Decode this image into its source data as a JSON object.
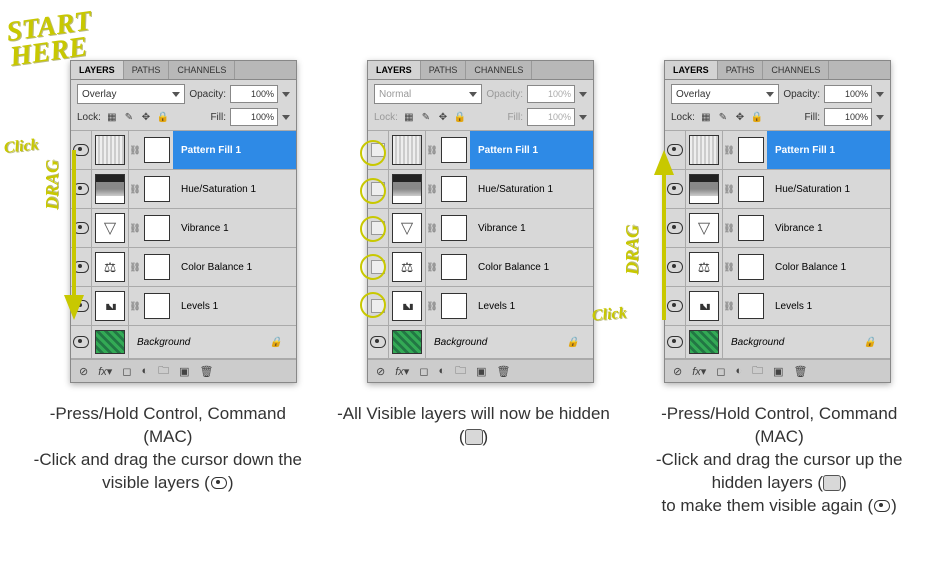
{
  "tabs": {
    "layers": "LAYERS",
    "paths": "PATHS",
    "channels": "CHANNELS"
  },
  "labels": {
    "opacity": "Opacity:",
    "lock": "Lock:",
    "fill": "Fill:"
  },
  "panel1": {
    "blend": "Overlay",
    "opacity": "100%",
    "fill": "100%",
    "layers": [
      {
        "name": "Pattern Fill 1",
        "visible": true,
        "selected": true,
        "adj": "pattern"
      },
      {
        "name": "Hue/Saturation 1",
        "visible": true,
        "selected": false,
        "adj": "hs"
      },
      {
        "name": "Vibrance 1",
        "visible": true,
        "selected": false,
        "adj": "vib"
      },
      {
        "name": "Color Balance 1",
        "visible": true,
        "selected": false,
        "adj": "cb"
      },
      {
        "name": "Levels 1",
        "visible": true,
        "selected": false,
        "adj": "lev"
      }
    ],
    "bg": "Background"
  },
  "panel2": {
    "blend": "Normal",
    "opacity": "100%",
    "fill": "100%",
    "layers": [
      {
        "name": "Pattern Fill 1",
        "visible": false,
        "selected": true,
        "adj": "pattern"
      },
      {
        "name": "Hue/Saturation 1",
        "visible": false,
        "selected": false,
        "adj": "hs"
      },
      {
        "name": "Vibrance 1",
        "visible": false,
        "selected": false,
        "adj": "vib"
      },
      {
        "name": "Color Balance 1",
        "visible": false,
        "selected": false,
        "adj": "cb"
      },
      {
        "name": "Levels 1",
        "visible": false,
        "selected": false,
        "adj": "lev"
      }
    ],
    "bg": "Background"
  },
  "panel3": {
    "blend": "Overlay",
    "opacity": "100%",
    "fill": "100%",
    "layers": [
      {
        "name": "Pattern Fill 1",
        "visible": true,
        "selected": true,
        "adj": "pattern"
      },
      {
        "name": "Hue/Saturation 1",
        "visible": true,
        "selected": false,
        "adj": "hs"
      },
      {
        "name": "Vibrance 1",
        "visible": true,
        "selected": false,
        "adj": "vib"
      },
      {
        "name": "Color Balance 1",
        "visible": true,
        "selected": false,
        "adj": "cb"
      },
      {
        "name": "Levels 1",
        "visible": true,
        "selected": false,
        "adj": "lev"
      }
    ],
    "bg": "Background"
  },
  "captions": {
    "c1a": "-Press/Hold Control, Command (MAC)",
    "c1b": "-Click and drag the cursor down the visible layers (",
    "c1c": ")",
    "c2a": "-All Visible layers will now be hidden (",
    "c2b": ")",
    "c3a": "-Press/Hold Control, Command (MAC)",
    "c3b": "-Click and drag the cursor up the hidden layers (",
    "c3c": ")",
    "c3d": "to make them visible again (",
    "c3e": ")"
  },
  "handwriting": {
    "start": "START\nHERE",
    "click": "Click",
    "drag": "DRAG"
  }
}
